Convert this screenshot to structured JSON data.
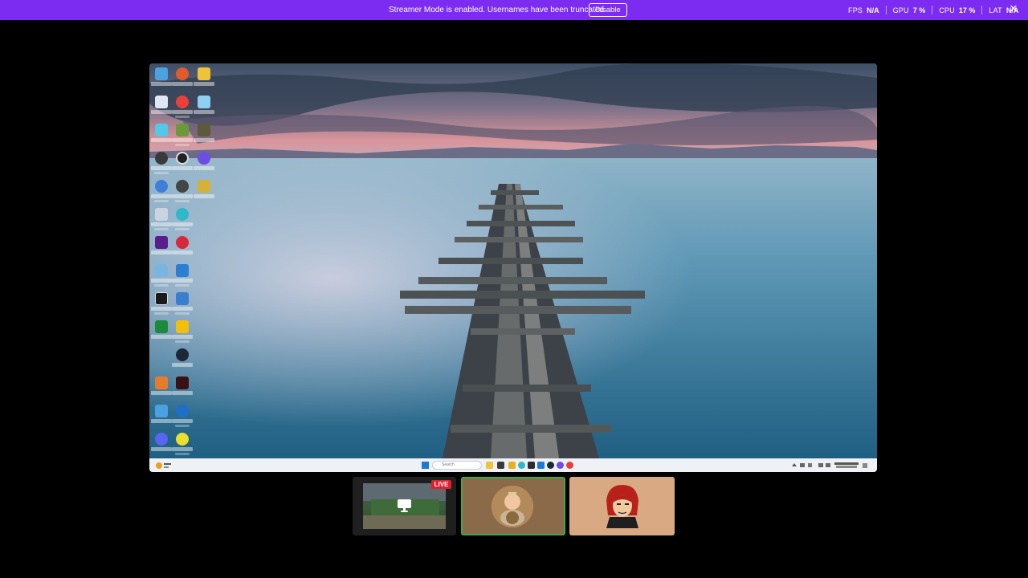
{
  "banner": {
    "message": "Streamer Mode is enabled. Usernames have been truncated.",
    "disable_label": "Disable",
    "close_icon": "close-icon",
    "color": "#7b2cf0"
  },
  "stats": [
    {
      "label": "FPS",
      "value": "N/A"
    },
    {
      "label": "GPU",
      "value": "7 %"
    },
    {
      "label": "CPU",
      "value": "17 %"
    },
    {
      "label": "LAT",
      "value": "N/A"
    }
  ],
  "stream": {
    "taskbar": {
      "search_placeholder": "Search"
    }
  },
  "tiles": {
    "screen_share_badge": "LIVE",
    "screen_icon": "monitor-icon",
    "active_border_color": "#3ea84a",
    "live_color": "#e01e2e"
  }
}
